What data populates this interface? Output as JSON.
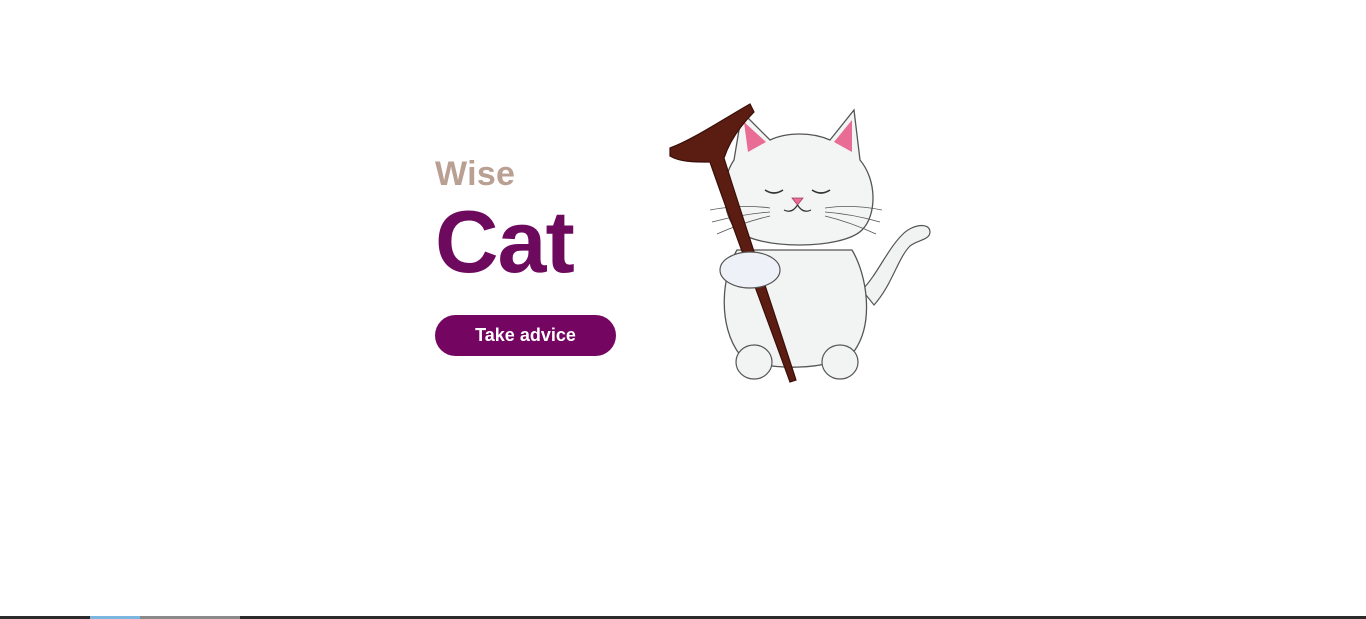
{
  "hero": {
    "kicker": "Wise",
    "title": "Cat",
    "cta_label": "Take advice"
  },
  "colors": {
    "kicker": "#b9a093",
    "title": "#6d0a5e",
    "button": "#740661",
    "background": "#ffffff"
  },
  "illustration": {
    "subject": "white-cat-with-wooden-staff"
  }
}
